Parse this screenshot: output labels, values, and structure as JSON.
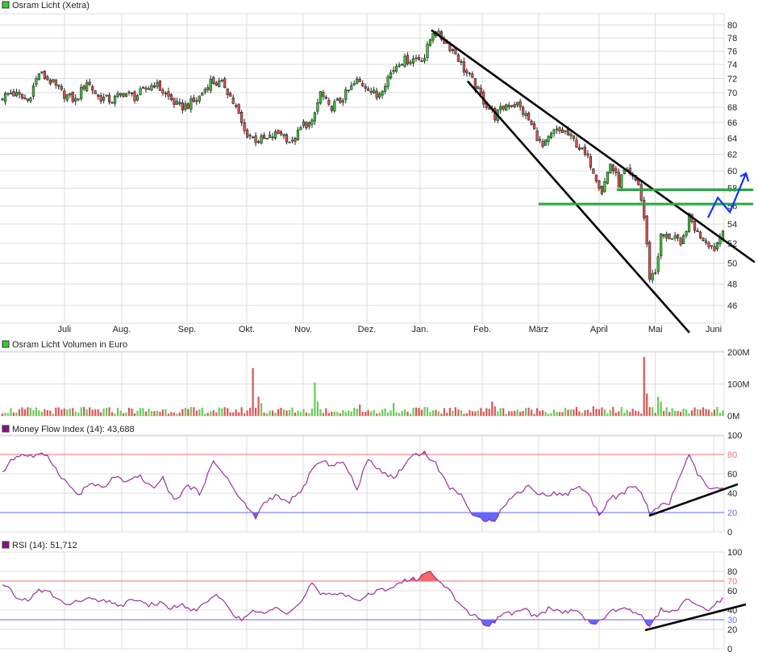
{
  "colors": {
    "up": "#33cc33",
    "down": "#e05050",
    "indicator": "#993399",
    "over": "#ff6666",
    "under": "#6666ff",
    "trend": "#000000",
    "support": "#22aa44",
    "arrow": "#1133ff"
  },
  "chart_data": [
    {
      "type": "candlestick",
      "title": "Osram Licht (Xetra)",
      "legend_icon": "green-square",
      "scale": "log",
      "ylim": [
        44.5,
        81.5
      ],
      "yticks": [
        46,
        48,
        50,
        52,
        54,
        56,
        58,
        60,
        62,
        64,
        66,
        68,
        70,
        72,
        74,
        76,
        78,
        80
      ],
      "x_unit": "trading day index",
      "days": 257,
      "months": [
        {
          "label": "Juli",
          "day": 22
        },
        {
          "label": "Aug.",
          "day": 42.4
        },
        {
          "label": "Sep.",
          "day": 65.6
        },
        {
          "label": "Okt.",
          "day": 86.8
        },
        {
          "label": "Nov.",
          "day": 106.9
        },
        {
          "label": "Dez.",
          "day": 129.5
        },
        {
          "label": "Jan.",
          "day": 148.4
        },
        {
          "label": "Feb.",
          "day": 170.5
        },
        {
          "label": "März",
          "day": 190.5
        },
        {
          "label": "April",
          "day": 212
        },
        {
          "label": "Mai",
          "day": 232
        },
        {
          "label": "Juni",
          "day": 252.7
        }
      ],
      "close_anchors": [
        [
          0,
          69.4
        ],
        [
          3,
          70.0
        ],
        [
          9,
          68.9
        ],
        [
          13,
          72.8
        ],
        [
          17,
          71.6
        ],
        [
          21,
          70.0
        ],
        [
          26,
          68.9
        ],
        [
          30,
          71.6
        ],
        [
          34,
          69.4
        ],
        [
          39,
          68.9
        ],
        [
          43,
          70.0
        ],
        [
          47,
          69.4
        ],
        [
          54,
          71.3
        ],
        [
          59,
          69.4
        ],
        [
          63,
          67.9
        ],
        [
          69,
          68.9
        ],
        [
          74,
          71.6
        ],
        [
          79,
          71.0
        ],
        [
          83,
          67.9
        ],
        [
          86,
          64.8
        ],
        [
          90,
          63.8
        ],
        [
          94,
          63.8
        ],
        [
          99,
          64.8
        ],
        [
          103,
          63.3
        ],
        [
          107,
          65.8
        ],
        [
          110,
          65.8
        ],
        [
          113,
          70.0
        ],
        [
          116,
          67.9
        ],
        [
          120,
          68.9
        ],
        [
          126,
          71.6
        ],
        [
          130,
          70.8
        ],
        [
          133,
          69.4
        ],
        [
          137,
          72.2
        ],
        [
          141,
          74.5
        ],
        [
          146,
          74.8
        ],
        [
          150,
          75.1
        ],
        [
          153,
          79.1
        ],
        [
          157,
          77.6
        ],
        [
          161,
          75.7
        ],
        [
          164,
          73.3
        ],
        [
          167,
          71.6
        ],
        [
          171,
          68.9
        ],
        [
          175,
          66.8
        ],
        [
          179,
          68.4
        ],
        [
          183,
          68.4
        ],
        [
          187,
          66.3
        ],
        [
          192,
          62.8
        ],
        [
          196,
          64.8
        ],
        [
          200,
          64.8
        ],
        [
          204,
          63.3
        ],
        [
          209,
          60.9
        ],
        [
          213,
          57.6
        ],
        [
          216,
          60.9
        ],
        [
          219,
          58.5
        ],
        [
          221,
          59.9
        ],
        [
          226,
          58.5
        ],
        [
          228,
          54.7
        ],
        [
          230,
          48.7
        ],
        [
          232,
          49.1
        ],
        [
          234,
          52.7
        ],
        [
          239,
          52.7
        ],
        [
          241,
          51.5
        ],
        [
          244,
          54.7
        ],
        [
          247,
          53.1
        ],
        [
          250,
          52.3
        ],
        [
          253,
          51.5
        ],
        [
          256,
          53.3
        ]
      ],
      "trendlines": [
        {
          "name": "upper-resistance-trendline",
          "from": [
            152.4,
            79.2
          ],
          "to": [
            267.3,
            50.1
          ],
          "color": "trend"
        },
        {
          "name": "lower-channel-trendline",
          "from": [
            165.3,
            71.6
          ],
          "to": [
            244.1,
            43.6
          ],
          "color": "trend"
        },
        {
          "name": "support-line-56",
          "from": [
            190.5,
            56.2
          ],
          "to": [
            266.8,
            56.2
          ],
          "color": "support"
        },
        {
          "name": "support-line-58",
          "from": [
            218.3,
            57.8
          ],
          "to": [
            266.8,
            57.8
          ],
          "color": "support"
        }
      ],
      "forecast_arrow": [
        [
          250.7,
          54.7
        ],
        [
          254.2,
          56.9
        ],
        [
          258.5,
          55.3
        ],
        [
          264.2,
          59.7
        ]
      ]
    },
    {
      "type": "bar",
      "title": "Osram Licht Volumen in Euro",
      "legend_icon": "green-square",
      "ylim": [
        0,
        200
      ],
      "yticks": [
        {
          "v": 0,
          "label": "0M"
        },
        {
          "v": 100,
          "label": "100M"
        },
        {
          "v": 200,
          "label": "200M"
        }
      ],
      "unit": "M EUR",
      "typical_range": [
        6,
        28
      ],
      "spikes": [
        [
          89,
          150
        ],
        [
          90,
          25
        ],
        [
          91,
          60
        ],
        [
          92,
          40
        ],
        [
          111,
          105
        ],
        [
          112,
          45
        ],
        [
          127,
          35
        ],
        [
          139,
          40
        ],
        [
          174,
          45
        ],
        [
          175,
          30
        ],
        [
          210,
          30
        ],
        [
          228,
          185
        ],
        [
          229,
          70
        ],
        [
          233,
          60
        ],
        [
          234,
          45
        ]
      ]
    },
    {
      "type": "line",
      "title": "Money Flow Index (14): 43,688",
      "legend_icon": "purple-square",
      "ylim": [
        0,
        100
      ],
      "yticks": [
        0,
        20,
        40,
        60,
        80,
        100
      ],
      "upper": 80,
      "lower": 20,
      "last_value": 43.688,
      "points": [
        [
          0,
          60
        ],
        [
          3,
          75
        ],
        [
          7,
          80
        ],
        [
          11,
          78
        ],
        [
          16,
          80
        ],
        [
          19,
          65
        ],
        [
          23,
          50
        ],
        [
          27,
          38
        ],
        [
          31,
          50
        ],
        [
          36,
          45
        ],
        [
          40,
          58
        ],
        [
          44,
          50
        ],
        [
          49,
          58
        ],
        [
          53,
          45
        ],
        [
          57,
          55
        ],
        [
          61,
          32
        ],
        [
          66,
          48
        ],
        [
          70,
          40
        ],
        [
          75,
          72
        ],
        [
          79,
          60
        ],
        [
          83,
          40
        ],
        [
          87,
          25
        ],
        [
          90,
          15
        ],
        [
          93,
          30
        ],
        [
          97,
          38
        ],
        [
          101,
          30
        ],
        [
          106,
          40
        ],
        [
          110,
          65
        ],
        [
          113,
          72
        ],
        [
          117,
          70
        ],
        [
          121,
          72
        ],
        [
          126,
          45
        ],
        [
          130,
          75
        ],
        [
          134,
          65
        ],
        [
          139,
          55
        ],
        [
          143,
          70
        ],
        [
          146,
          80
        ],
        [
          150,
          82
        ],
        [
          154,
          70
        ],
        [
          159,
          45
        ],
        [
          163,
          40
        ],
        [
          167,
          15
        ],
        [
          171,
          13
        ],
        [
          175,
          13
        ],
        [
          179,
          30
        ],
        [
          183,
          40
        ],
        [
          187,
          48
        ],
        [
          191,
          38
        ],
        [
          196,
          40
        ],
        [
          200,
          38
        ],
        [
          205,
          48
        ],
        [
          209,
          35
        ],
        [
          212,
          18
        ],
        [
          216,
          35
        ],
        [
          220,
          38
        ],
        [
          224,
          48
        ],
        [
          227,
          40
        ],
        [
          230,
          20
        ],
        [
          233,
          25
        ],
        [
          237,
          30
        ],
        [
          241,
          60
        ],
        [
          244,
          78
        ],
        [
          247,
          60
        ],
        [
          251,
          45
        ],
        [
          256,
          44
        ]
      ],
      "trendline": {
        "from": [
          229.8,
          16.7
        ],
        "to": [
          261.3,
          49.2
        ]
      }
    },
    {
      "type": "line",
      "title": "RSI (14): 51,712",
      "legend_icon": "purple-square",
      "ylim": [
        0,
        100
      ],
      "yticks": [
        0,
        20,
        30,
        40,
        60,
        70,
        80,
        100
      ],
      "upper": 70,
      "lower": 30,
      "last_value": 51.712,
      "points": [
        [
          0,
          65
        ],
        [
          3,
          60
        ],
        [
          6,
          50
        ],
        [
          10,
          52
        ],
        [
          13,
          60
        ],
        [
          17,
          58
        ],
        [
          20,
          50
        ],
        [
          24,
          45
        ],
        [
          29,
          52
        ],
        [
          33,
          50
        ],
        [
          37,
          48
        ],
        [
          43,
          45
        ],
        [
          47,
          52
        ],
        [
          51,
          45
        ],
        [
          56,
          47
        ],
        [
          60,
          42
        ],
        [
          64,
          45
        ],
        [
          69,
          38
        ],
        [
          73,
          50
        ],
        [
          77,
          55
        ],
        [
          81,
          40
        ],
        [
          85,
          28
        ],
        [
          89,
          40
        ],
        [
          93,
          35
        ],
        [
          97,
          45
        ],
        [
          101,
          38
        ],
        [
          106,
          47
        ],
        [
          110,
          68
        ],
        [
          113,
          55
        ],
        [
          117,
          56
        ],
        [
          121,
          58
        ],
        [
          126,
          50
        ],
        [
          130,
          55
        ],
        [
          134,
          60
        ],
        [
          139,
          65
        ],
        [
          143,
          70
        ],
        [
          147,
          72
        ],
        [
          151,
          80
        ],
        [
          156,
          70
        ],
        [
          160,
          55
        ],
        [
          164,
          40
        ],
        [
          169,
          32
        ],
        [
          173,
          22
        ],
        [
          177,
          35
        ],
        [
          181,
          37
        ],
        [
          186,
          40
        ],
        [
          190,
          32
        ],
        [
          194,
          42
        ],
        [
          199,
          38
        ],
        [
          203,
          40
        ],
        [
          207,
          32
        ],
        [
          211,
          25
        ],
        [
          216,
          38
        ],
        [
          220,
          42
        ],
        [
          224,
          38
        ],
        [
          227,
          35
        ],
        [
          230,
          23
        ],
        [
          234,
          40
        ],
        [
          239,
          38
        ],
        [
          243,
          50
        ],
        [
          247,
          45
        ],
        [
          251,
          40
        ],
        [
          256,
          52
        ]
      ],
      "trendline": {
        "from": [
          228.4,
          19.2
        ],
        "to": [
          264.2,
          45.8
        ]
      }
    }
  ]
}
